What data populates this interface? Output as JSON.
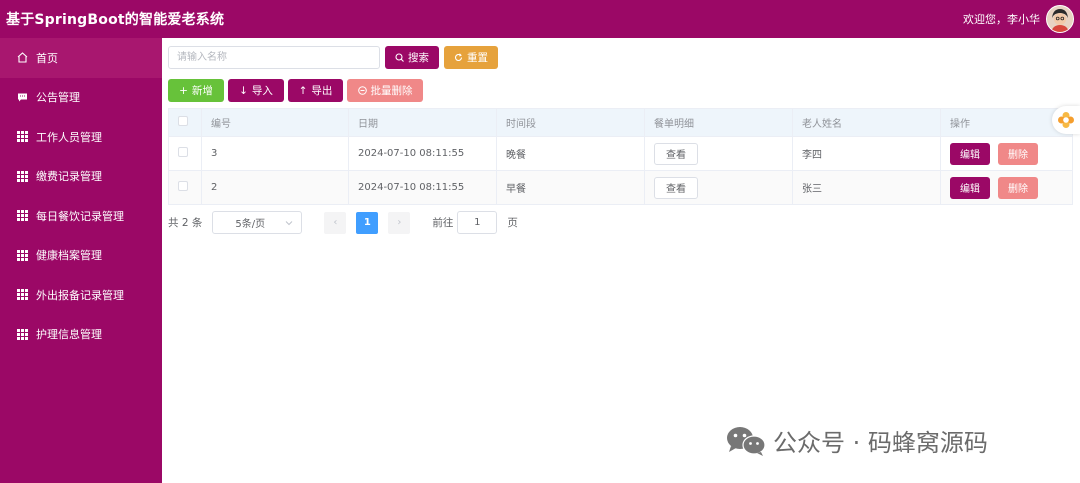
{
  "header": {
    "title": "基于SpringBoot的智能爱老系统",
    "welcome": "欢迎您，李小华"
  },
  "sidebar": {
    "items": [
      {
        "label": "首页",
        "icon": "home-icon"
      },
      {
        "label": "公告管理",
        "icon": "message-icon"
      },
      {
        "label": "工作人员管理",
        "icon": "grid-icon"
      },
      {
        "label": "缴费记录管理",
        "icon": "grid-icon"
      },
      {
        "label": "每日餐饮记录管理",
        "icon": "grid-icon"
      },
      {
        "label": "健康档案管理",
        "icon": "grid-icon"
      },
      {
        "label": "外出报备记录管理",
        "icon": "grid-icon"
      },
      {
        "label": "护理信息管理",
        "icon": "grid-icon"
      }
    ]
  },
  "search": {
    "placeholder": "请输入名称",
    "search_label": "搜索",
    "reset_label": "重置"
  },
  "actions": {
    "add_label": "新增",
    "import_label": "导入",
    "export_label": "导出",
    "batch_delete_label": "批量删除"
  },
  "table": {
    "columns": [
      "编号",
      "日期",
      "时间段",
      "餐单明细",
      "老人姓名",
      "操作"
    ],
    "rows": [
      {
        "id": "3",
        "date": "2024-07-10 08:11:55",
        "period": "晚餐",
        "detail_btn": "查看",
        "name": "李四",
        "edit": "编辑",
        "delete": "删除"
      },
      {
        "id": "2",
        "date": "2024-07-10 08:11:55",
        "period": "早餐",
        "detail_btn": "查看",
        "name": "张三",
        "edit": "编辑",
        "delete": "删除"
      }
    ]
  },
  "pagination": {
    "total": "共 2 条",
    "page_size": "5条/页",
    "current_page": "1",
    "goto_label": "前往",
    "goto_value": "1",
    "page_suffix": "页"
  },
  "watermark": {
    "text": "公众号 · 码蜂窝源码"
  },
  "colors": {
    "brand": "#9b0866",
    "warning": "#e6a23c",
    "success": "#67c23a",
    "danger_light": "#f08888",
    "primary": "#409eff"
  }
}
